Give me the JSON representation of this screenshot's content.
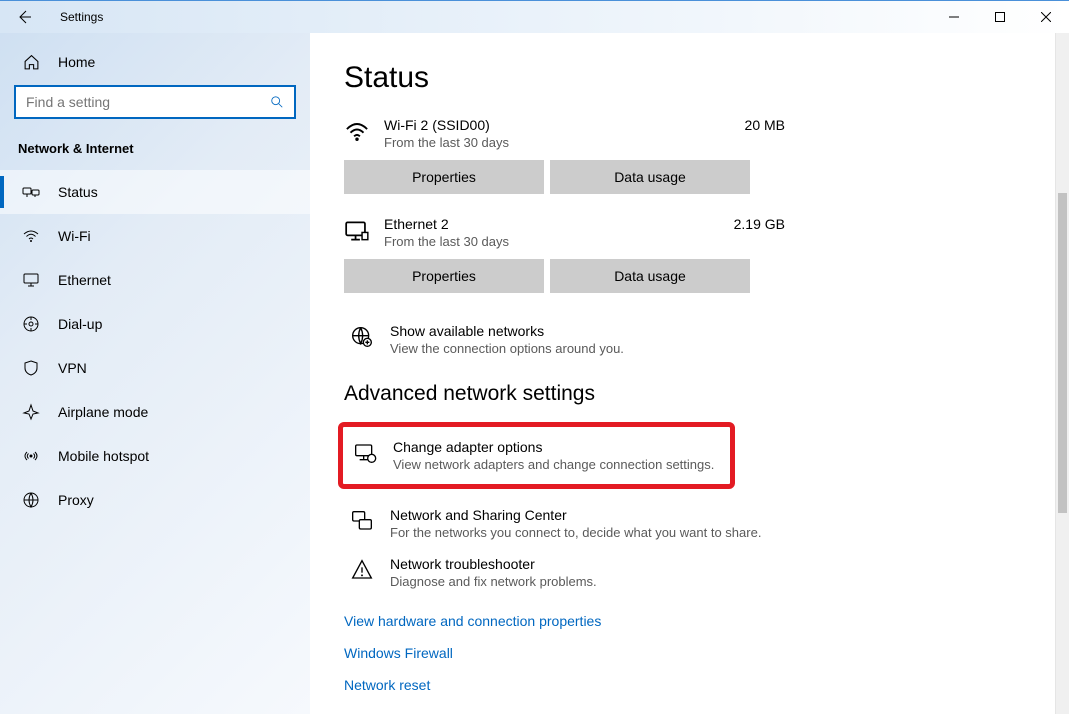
{
  "titlebar": {
    "title": "Settings"
  },
  "sidebar": {
    "home": "Home",
    "search_placeholder": "Find a setting",
    "section": "Network & Internet",
    "items": [
      {
        "label": "Status",
        "icon": "status"
      },
      {
        "label": "Wi-Fi",
        "icon": "wifi"
      },
      {
        "label": "Ethernet",
        "icon": "ethernet"
      },
      {
        "label": "Dial-up",
        "icon": "dialup"
      },
      {
        "label": "VPN",
        "icon": "vpn"
      },
      {
        "label": "Airplane mode",
        "icon": "airplane"
      },
      {
        "label": "Mobile hotspot",
        "icon": "hotspot"
      },
      {
        "label": "Proxy",
        "icon": "proxy"
      }
    ]
  },
  "content": {
    "heading": "Status",
    "networks": [
      {
        "name": "Wi-Fi 2 (SSID00)",
        "sub": "From the last 30 days",
        "usage": "20 MB",
        "icon": "wifi"
      },
      {
        "name": "Ethernet 2",
        "sub": "From the last 30 days",
        "usage": "2.19 GB",
        "icon": "ethernet"
      }
    ],
    "buttons": {
      "properties": "Properties",
      "data_usage": "Data usage"
    },
    "showNetworks": {
      "title": "Show available networks",
      "sub": "View the connection options around you."
    },
    "advanced": {
      "heading": "Advanced network settings",
      "items": [
        {
          "title": "Change adapter options",
          "sub": "View network adapters and change connection settings.",
          "highlight": true
        },
        {
          "title": "Network and Sharing Center",
          "sub": "For the networks you connect to, decide what you want to share."
        },
        {
          "title": "Network troubleshooter",
          "sub": "Diagnose and fix network problems."
        }
      ],
      "links": [
        "View hardware and connection properties",
        "Windows Firewall",
        "Network reset"
      ]
    }
  }
}
